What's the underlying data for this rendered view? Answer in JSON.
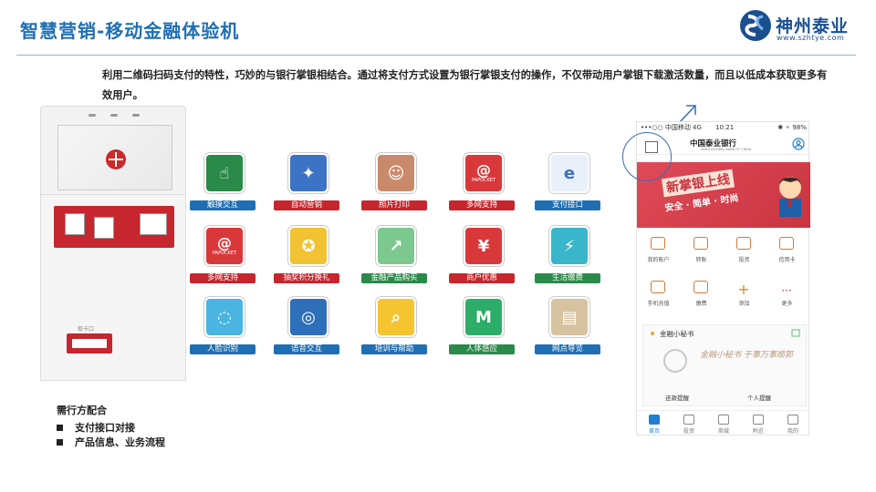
{
  "header": {
    "title": "智慧营销-移动金融体验机"
  },
  "logo": {
    "name": "神州泰业",
    "url": "www.szhtye.com"
  },
  "intro": "利用二维码扫码支付的特性，巧妙的与银行掌银相结合。通过将支付方式设置为银行掌银支付的操作，不仅带动用户掌银下载激活数量，而且以低成本获取更多有效用户。",
  "kiosk": {
    "panel_label": "取卡口",
    "printer_label": "取卡口"
  },
  "features": [
    {
      "label": "触摸交互",
      "icon": "touch-icon",
      "bg": "#2a8a4a",
      "lbl_bg": "#1f6fb2"
    },
    {
      "label": "自动营销",
      "icon": "marketing-icon",
      "bg": "#3b74c4",
      "lbl_bg": "#c6262e"
    },
    {
      "label": "照片打印",
      "icon": "photo-icon",
      "bg": "#c98a6b",
      "lbl_bg": "#c6262e"
    },
    {
      "label": "多网支持",
      "icon": "papocket-icon",
      "bg": "#d9383a",
      "lbl_bg": "#c6262e",
      "text": "PAPOCKET"
    },
    {
      "label": "支付接口",
      "icon": "payment-e-icon",
      "bg": "#e8f0fa",
      "lbl_bg": "#1f6fb2"
    },
    {
      "label": "多网支持",
      "icon": "papocket-icon",
      "bg": "#d9383a",
      "lbl_bg": "#c6262e",
      "text": "PAPOCKET"
    },
    {
      "label": "抽奖积分换礼",
      "icon": "lottery-wheel-icon",
      "bg": "#f1c232",
      "lbl_bg": "#c6262e"
    },
    {
      "label": "金融产品购买",
      "icon": "growth-chart-icon",
      "bg": "#7cc88f",
      "lbl_bg": "#2a8a4a"
    },
    {
      "label": "商户优惠",
      "icon": "coupon-icon",
      "bg": "#d9383a",
      "lbl_bg": "#c6262e"
    },
    {
      "label": "生活缴费",
      "icon": "lightning-icon",
      "bg": "#39b6c9",
      "lbl_bg": "#2a8a4a"
    },
    {
      "label": "人脸识别",
      "icon": "face-id-icon",
      "bg": "#49b5e0",
      "lbl_bg": "#1f6fb2"
    },
    {
      "label": "语音交互",
      "icon": "voice-icon",
      "bg": "#2d6fb8",
      "lbl_bg": "#1f6fb2"
    },
    {
      "label": "培训与帮助",
      "icon": "search-book-icon",
      "bg": "#f4c431",
      "lbl_bg": "#1f6fb2"
    },
    {
      "label": "人体感应",
      "icon": "m-logo-icon",
      "bg": "#2cae68",
      "lbl_bg": "#2a8a4a"
    },
    {
      "label": "网点导览",
      "icon": "branch-photo-icon",
      "bg": "#d8c3a0",
      "lbl_bg": "#1f6fb2"
    }
  ],
  "phone": {
    "status": {
      "carrier": "•••○○ 中国移动 4G",
      "time": "10:21",
      "battery": "✺ ⚬ 98%"
    },
    "bank_name": "中国泰业银行",
    "bank_sub": "AGRICULTURAL BANK OF CHINA",
    "banner_title": "新掌银上线",
    "banner_sub": "安全 · 简单 · 时尚",
    "grid": [
      {
        "label": "我的账户"
      },
      {
        "label": "转账"
      },
      {
        "label": "投资"
      },
      {
        "label": "信用卡"
      },
      {
        "label": "手机充值"
      },
      {
        "label": "缴费"
      },
      {
        "label": "添加"
      },
      {
        "label": "更多"
      }
    ],
    "card_title": "金融小秘书",
    "card_sig": "金融小秘书 于事万事顺郭",
    "card_r1": "还款提醒",
    "card_r2": "个人提醒",
    "tabs": [
      {
        "label": "首页"
      },
      {
        "label": "投资"
      },
      {
        "label": "商城"
      },
      {
        "label": "附近"
      },
      {
        "label": "我的"
      }
    ]
  },
  "needs": {
    "title": "需行方配合",
    "items": [
      "支付接口对接",
      "产品信息、业务流程"
    ]
  }
}
